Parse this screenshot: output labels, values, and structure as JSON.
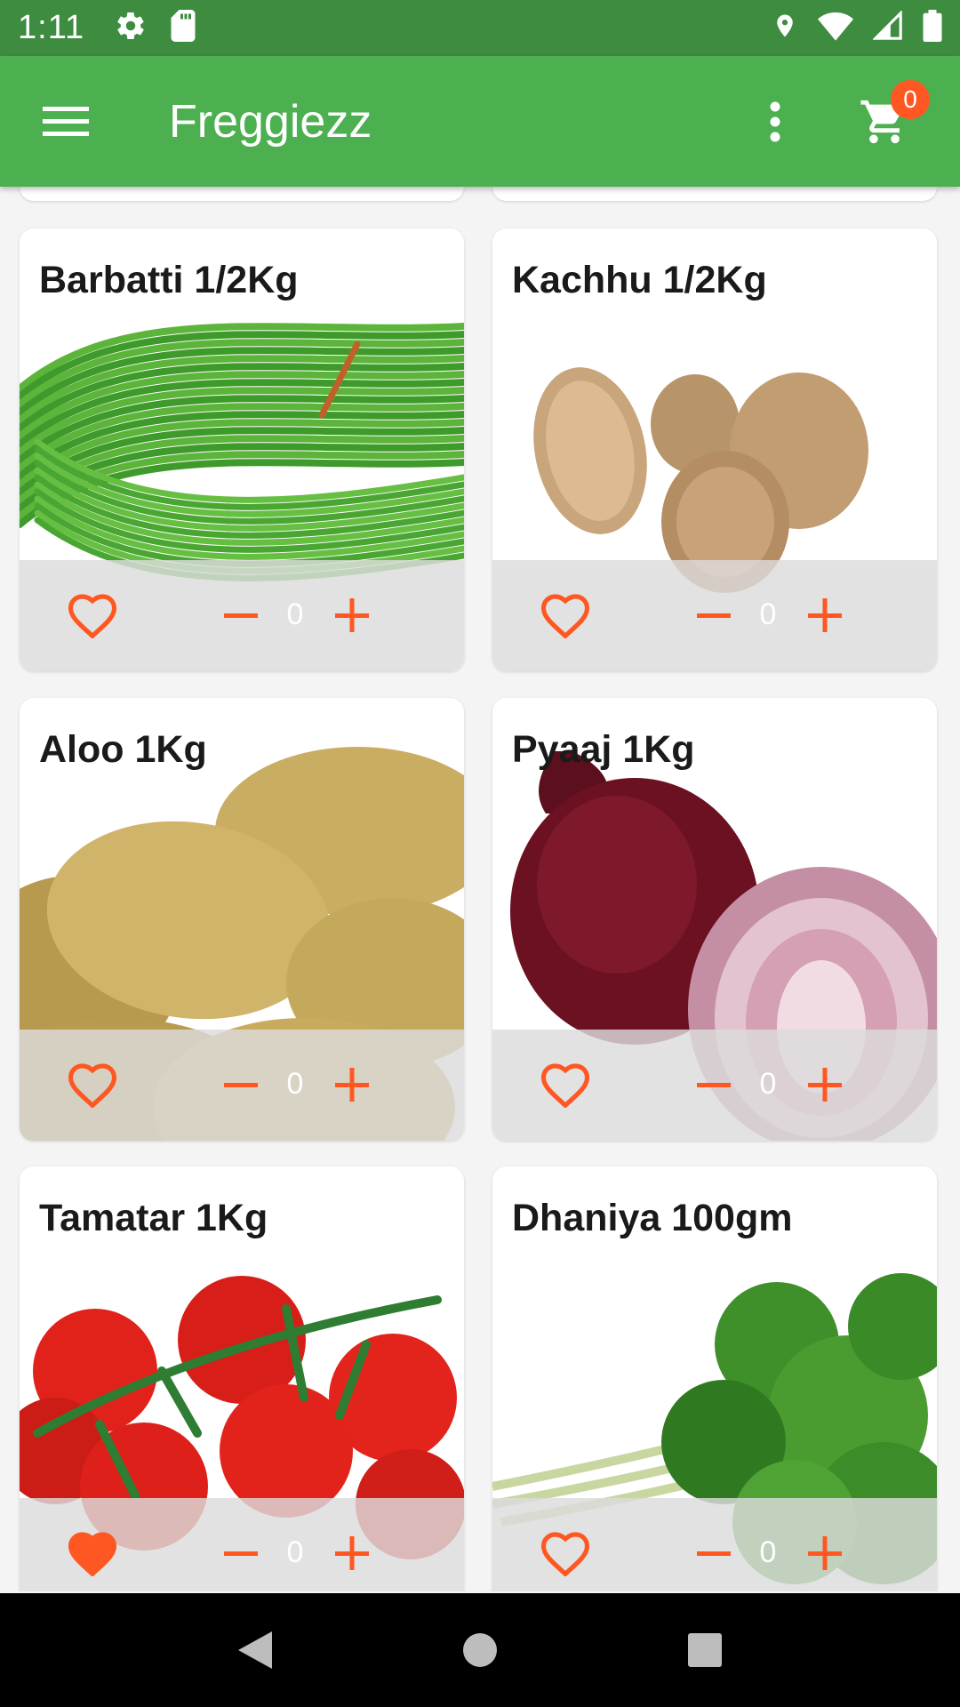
{
  "status_bar": {
    "time": "1:11",
    "icons": [
      "settings-icon",
      "sd-card-icon",
      "location-icon",
      "wifi-icon",
      "signal-icon",
      "battery-icon"
    ]
  },
  "app_bar": {
    "title": "Freggiezz",
    "cart_count": "0",
    "icons": [
      "menu-icon",
      "more-vert-icon",
      "cart-icon"
    ]
  },
  "colors": {
    "status_bar": "#3d8c40",
    "app_bar": "#4caf50",
    "accent": "#ff5722"
  },
  "products": [
    {
      "name": "Barbatti 1/2Kg",
      "qty": "0",
      "favorite": false,
      "image": "green-beans"
    },
    {
      "name": "Kachhu 1/2Kg",
      "qty": "0",
      "favorite": false,
      "image": "taro-roots"
    },
    {
      "name": "Aloo 1Kg",
      "qty": "0",
      "favorite": false,
      "image": "potatoes"
    },
    {
      "name": "Pyaaj 1Kg",
      "qty": "0",
      "favorite": false,
      "image": "red-onions"
    },
    {
      "name": "Tamatar 1Kg",
      "qty": "0",
      "favorite": true,
      "image": "tomatoes"
    },
    {
      "name": "Dhaniya 100gm",
      "qty": "0",
      "favorite": false,
      "image": "coriander"
    }
  ],
  "nav_bar": [
    "back-icon",
    "home-icon",
    "recents-icon"
  ]
}
